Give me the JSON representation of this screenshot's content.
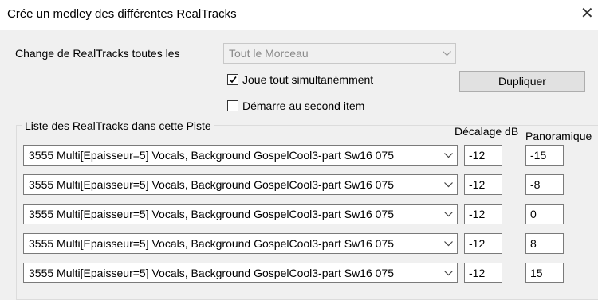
{
  "dialog": {
    "title": "Crée un medley des différentes RealTracks",
    "close_icon": "close-icon"
  },
  "change_every": {
    "label": "Change de RealTracks toutes les",
    "value": "Tout le Morceau"
  },
  "options": {
    "simultaneous_label": "Joue tout simultanémment",
    "simultaneous_checked": true,
    "second_item_label": "Démarre au second item",
    "second_item_checked": false
  },
  "duplicate_button": "Dupliquer",
  "list": {
    "group_label": "Liste des RealTracks dans cette Piste",
    "col_offset": "Décalage dB",
    "col_pan": "Panoramique",
    "rows": [
      {
        "track": "3555 Multi[Epaisseur=5]  Vocals, Background GospelCool3-part Sw16 075",
        "offset": "-12",
        "pan": "-15"
      },
      {
        "track": "3555 Multi[Epaisseur=5]  Vocals, Background GospelCool3-part Sw16 075",
        "offset": "-12",
        "pan": "-8"
      },
      {
        "track": "3555 Multi[Epaisseur=5]  Vocals, Background GospelCool3-part Sw16 075",
        "offset": "-12",
        "pan": "0"
      },
      {
        "track": "3555 Multi[Epaisseur=5]  Vocals, Background GospelCool3-part Sw16 075",
        "offset": "-12",
        "pan": "8"
      },
      {
        "track": "3555 Multi[Epaisseur=5]  Vocals, Background GospelCool3-part Sw16 075",
        "offset": "-12",
        "pan": "15"
      }
    ]
  }
}
